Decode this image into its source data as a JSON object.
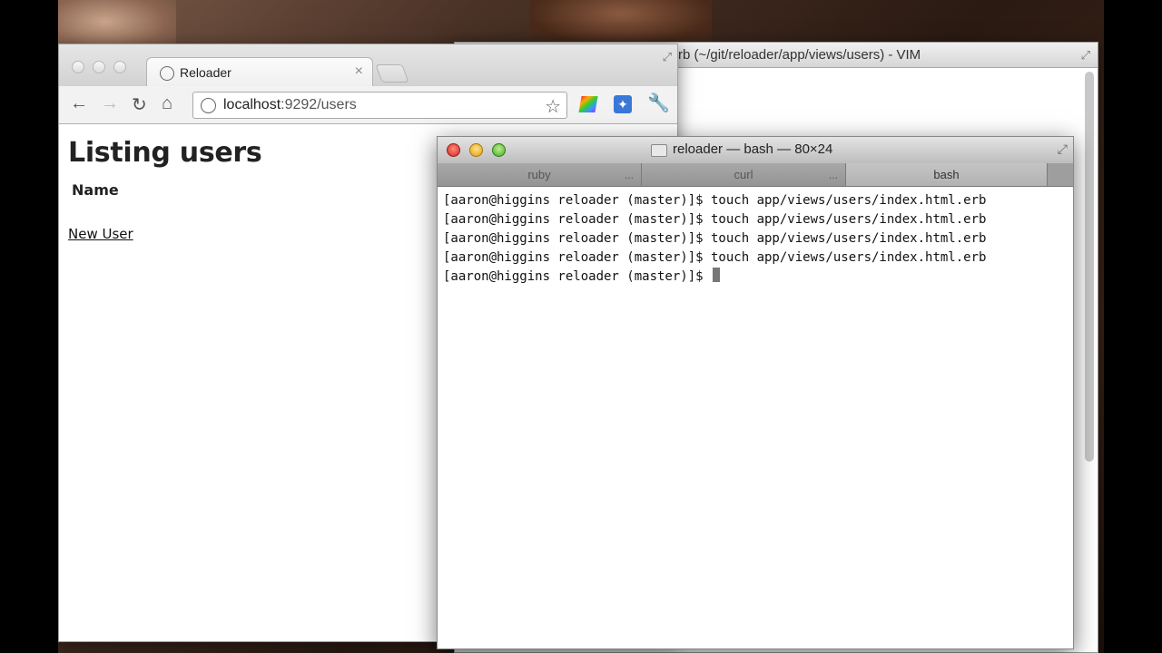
{
  "vim": {
    "title": "rb (~/git/reloader/app/views/users) - VIM"
  },
  "chrome": {
    "tab_title": "Reloader",
    "tab_close": "×",
    "url_host": "localhost",
    "url_path": ":9292/users",
    "page": {
      "heading": "Listing users",
      "column_header": "Name",
      "link": "New User"
    }
  },
  "terminal": {
    "title": "reloader — bash — 80×24",
    "tabs": [
      {
        "label": "ruby",
        "dots": "..."
      },
      {
        "label": "curl",
        "dots": "..."
      },
      {
        "label": "bash",
        "dots": ""
      }
    ],
    "lines": [
      "[aaron@higgins reloader (master)]$ touch app/views/users/index.html.erb",
      "[aaron@higgins reloader (master)]$ touch app/views/users/index.html.erb",
      "[aaron@higgins reloader (master)]$ touch app/views/users/index.html.erb",
      "[aaron@higgins reloader (master)]$ touch app/views/users/index.html.erb"
    ],
    "prompt": "[aaron@higgins reloader (master)]$ "
  },
  "icons": [
    "back-icon",
    "forward-icon",
    "reload-icon",
    "home-icon",
    "globe-icon",
    "star-icon",
    "extension-icon",
    "wrench-icon",
    "folder-icon",
    "resize-icon"
  ]
}
